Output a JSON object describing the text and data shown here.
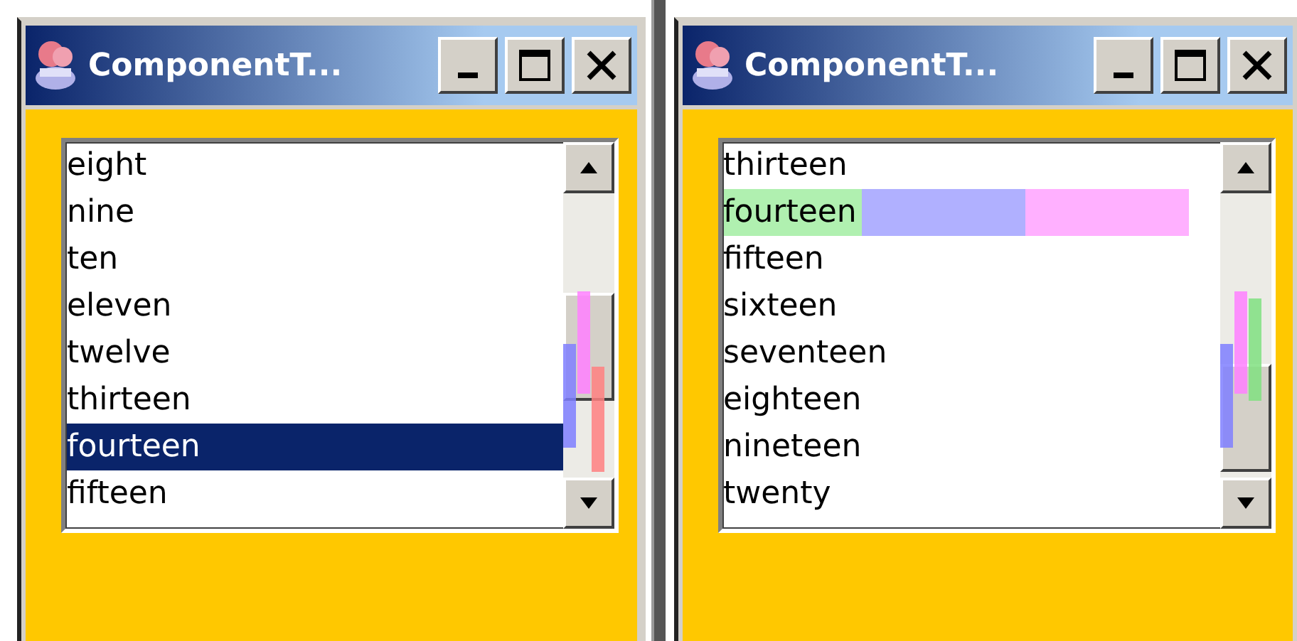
{
  "windows": [
    {
      "title": "ComponentT...",
      "list": {
        "items": [
          {
            "label": "eight",
            "selected": false,
            "highlighted": false
          },
          {
            "label": "nine",
            "selected": false,
            "highlighted": false
          },
          {
            "label": "ten",
            "selected": false,
            "highlighted": false
          },
          {
            "label": "eleven",
            "selected": false,
            "highlighted": false
          },
          {
            "label": "twelve",
            "selected": false,
            "highlighted": false
          },
          {
            "label": "thirteen",
            "selected": false,
            "highlighted": false
          },
          {
            "label": "fourteen",
            "selected": true,
            "highlighted": false
          },
          {
            "label": "fifteen",
            "selected": false,
            "highlighted": false
          }
        ],
        "markers": [
          {
            "color": "#7f7fff"
          },
          {
            "color": "#ff80ff"
          },
          {
            "color": "#ff8080"
          }
        ]
      }
    },
    {
      "title": "ComponentT...",
      "list": {
        "items": [
          {
            "label": "thirteen",
            "selected": false,
            "highlighted": false
          },
          {
            "label": "fourteen",
            "selected": false,
            "highlighted": true
          },
          {
            "label": "fifteen",
            "selected": false,
            "highlighted": false
          },
          {
            "label": "sixteen",
            "selected": false,
            "highlighted": false
          },
          {
            "label": "seventeen",
            "selected": false,
            "highlighted": false
          },
          {
            "label": "eighteen",
            "selected": false,
            "highlighted": false
          },
          {
            "label": "nineteen",
            "selected": false,
            "highlighted": false
          },
          {
            "label": "twenty",
            "selected": false,
            "highlighted": false
          }
        ],
        "markers": [
          {
            "color": "#7f7fff"
          },
          {
            "color": "#ff80ff"
          },
          {
            "color": "#80e080"
          }
        ]
      }
    }
  ]
}
